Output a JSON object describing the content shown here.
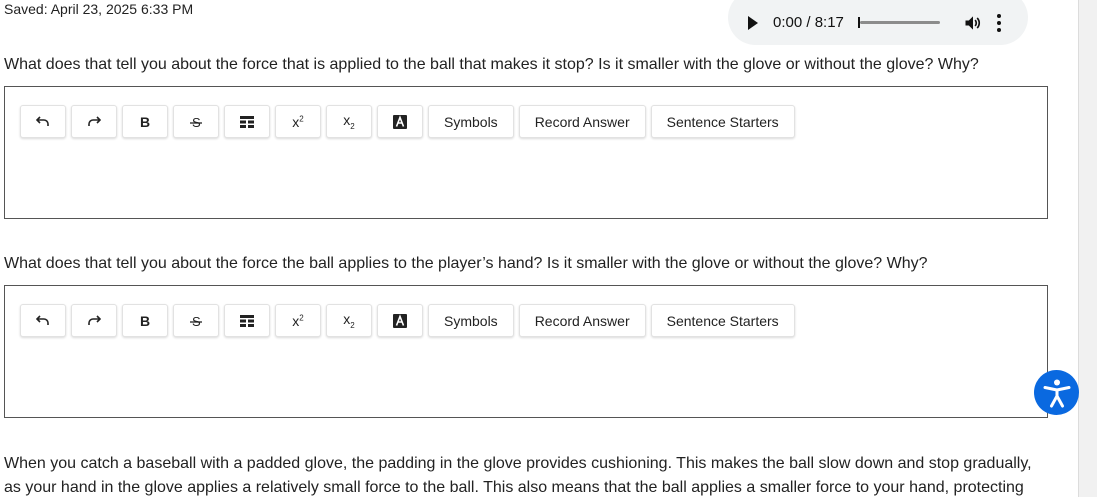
{
  "saved_status": "Saved: April 23, 2025 6:33 PM",
  "audio": {
    "time": "0:00 / 8:17",
    "progress": 0
  },
  "question1": "What does that tell you about the force that is applied to the ball that makes it stop? Is it smaller with the glove or without the glove? Why?",
  "question2": "What does that tell you about the force the ball applies to the player’s hand? Is it smaller with the glove or without the glove? Why?",
  "toolbar": {
    "symbols": "Symbols",
    "record": "Record Answer",
    "starters": "Sentence Starters",
    "superscript": "x",
    "subscript": "x",
    "sup_mark": "2",
    "sub_mark": "2",
    "bold": "B"
  },
  "passage": "When you catch a baseball with a padded glove, the padding in the glove provides cushioning. This makes the ball slow down and stop gradually, as your hand in the glove applies a relatively small force to the ball. This also means that the ball applies a smaller force to your hand, protecting"
}
